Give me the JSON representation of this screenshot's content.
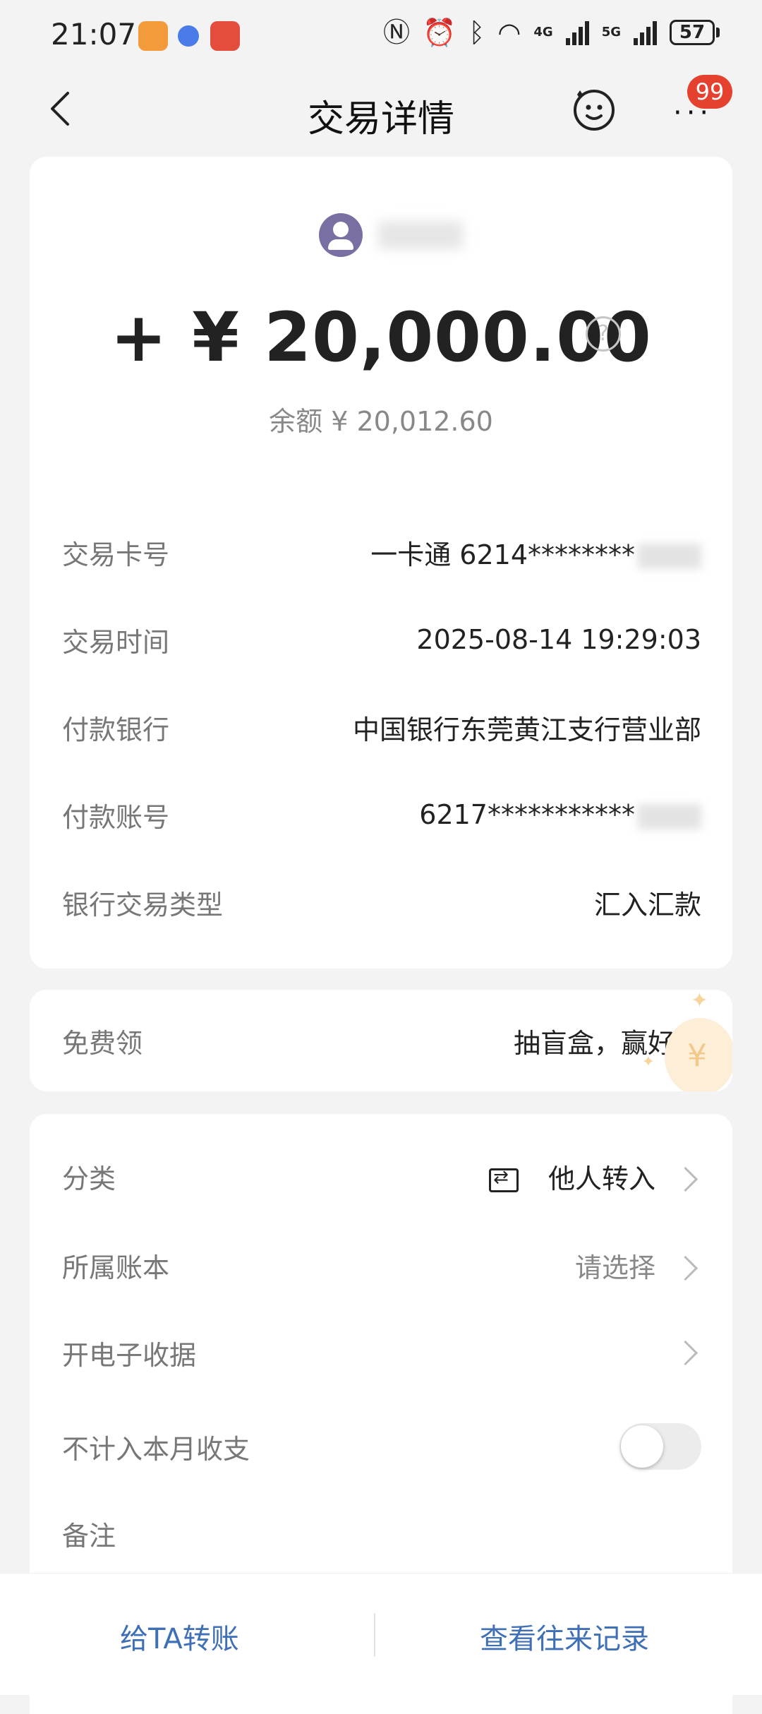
{
  "status": {
    "time": "21:07",
    "network1": "4G",
    "network2": "5G",
    "battery": "57"
  },
  "header": {
    "title": "交易详情",
    "badge": "99"
  },
  "summary": {
    "amount": "+ ¥ 20,000.00",
    "balance": "余额 ¥ 20,012.60",
    "help_symbol": "?"
  },
  "details": [
    {
      "label": "交易卡号",
      "value": "一卡通 6214********"
    },
    {
      "label": "交易时间",
      "value": "2025-08-14 19:29:03"
    },
    {
      "label": "付款银行",
      "value": "中国银行东莞黄江支行营业部"
    },
    {
      "label": "付款账号",
      "value": "6217***********"
    },
    {
      "label": "银行交易类型",
      "value": "汇入汇款"
    }
  ],
  "promo": {
    "label": "免费领",
    "value": "抽盲盒，赢好礼"
  },
  "settings": {
    "category_label": "分类",
    "category_value": "他人转入",
    "ledger_label": "所属账本",
    "ledger_value": "请选择",
    "receipt_label": "开电子收据",
    "exclude_label": "不计入本月收支",
    "exclude_on": false,
    "note_label": "备注"
  },
  "bottom": {
    "transfer": "给TA转账",
    "history": "查看往来记录"
  },
  "colors": {
    "accent": "#3f6fb5",
    "badge": "#e5412f",
    "avatar": "#7a6fa2"
  }
}
